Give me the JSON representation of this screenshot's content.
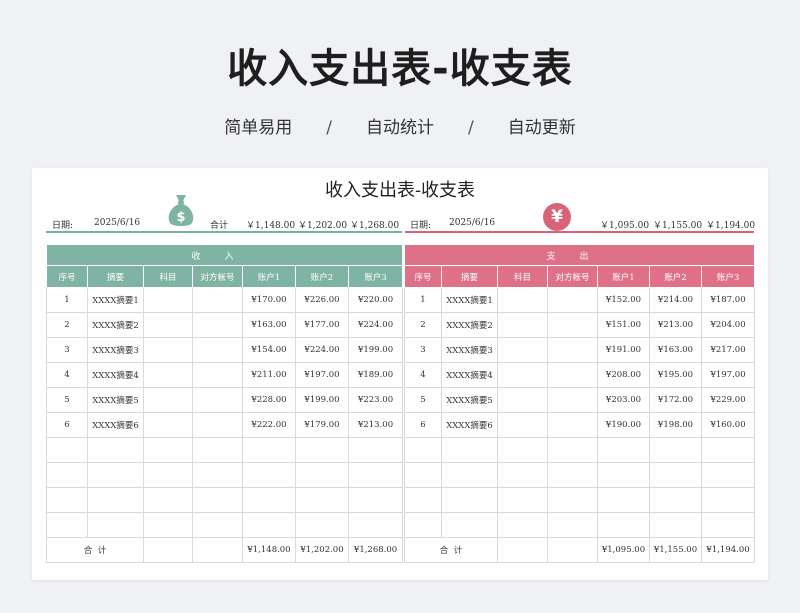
{
  "page": {
    "title": "收入支出表-收支表",
    "subtitle": [
      "简单易用",
      "自动统计",
      "自动更新"
    ],
    "separator": "/"
  },
  "sheet": {
    "title": "收入支出表-收支表",
    "left_icon": "money-bag-icon",
    "right_icon": "yen-circle-icon",
    "accent_income": "#7fb3a3",
    "accent_expense": "#de7088",
    "income": {
      "date_label": "日期:",
      "date": "2025/6/16",
      "total_label": "合计",
      "totals": [
        "￥1,148.00",
        "￥1,202.00",
        "￥1,268.00"
      ],
      "band": "收入",
      "headers": [
        "序号",
        "摘要",
        "科目",
        "对方帐号",
        "账户1",
        "账户2",
        "账户3"
      ],
      "rows": [
        [
          "1",
          "XXXX摘要1",
          "",
          "",
          "¥170.00",
          "¥226.00",
          "¥220.00"
        ],
        [
          "2",
          "XXXX摘要2",
          "",
          "",
          "¥163.00",
          "¥177.00",
          "¥224.00"
        ],
        [
          "3",
          "XXXX摘要3",
          "",
          "",
          "¥154.00",
          "¥224.00",
          "¥199.00"
        ],
        [
          "4",
          "XXXX摘要4",
          "",
          "",
          "¥211.00",
          "¥197.00",
          "¥189.00"
        ],
        [
          "5",
          "XXXX摘要5",
          "",
          "",
          "¥228.00",
          "¥199.00",
          "¥223.00"
        ],
        [
          "6",
          "XXXX摘要6",
          "",
          "",
          "¥222.00",
          "¥179.00",
          "¥213.00"
        ],
        [
          "",
          "",
          "",
          "",
          "",
          "",
          ""
        ],
        [
          "",
          "",
          "",
          "",
          "",
          "",
          ""
        ],
        [
          "",
          "",
          "",
          "",
          "",
          "",
          ""
        ],
        [
          "",
          "",
          "",
          "",
          "",
          "",
          ""
        ]
      ],
      "footer_label": "合  计",
      "footer": [
        "¥1,148.00",
        "¥1,202.00",
        "¥1,268.00"
      ]
    },
    "expense": {
      "date_label": "日期:",
      "date": "2025/6/16",
      "totals": [
        "￥1,095.00",
        "￥1,155.00",
        "￥1,194.00"
      ],
      "band": "支出",
      "headers": [
        "序号",
        "摘要",
        "科目",
        "对方帐号",
        "账户1",
        "账户2",
        "账户3"
      ],
      "rows": [
        [
          "1",
          "XXXX摘要1",
          "",
          "",
          "¥152.00",
          "¥214.00",
          "¥187.00"
        ],
        [
          "2",
          "XXXX摘要2",
          "",
          "",
          "¥151.00",
          "¥213.00",
          "¥204.00"
        ],
        [
          "3",
          "XXXX摘要3",
          "",
          "",
          "¥191.00",
          "¥163.00",
          "¥217.00"
        ],
        [
          "4",
          "XXXX摘要4",
          "",
          "",
          "¥208.00",
          "¥195.00",
          "¥197.00"
        ],
        [
          "5",
          "XXXX摘要5",
          "",
          "",
          "¥203.00",
          "¥172.00",
          "¥229.00"
        ],
        [
          "6",
          "XXXX摘要6",
          "",
          "",
          "¥190.00",
          "¥198.00",
          "¥160.00"
        ],
        [
          "",
          "",
          "",
          "",
          "",
          "",
          ""
        ],
        [
          "",
          "",
          "",
          "",
          "",
          "",
          ""
        ],
        [
          "",
          "",
          "",
          "",
          "",
          "",
          ""
        ],
        [
          "",
          "",
          "",
          "",
          "",
          "",
          ""
        ]
      ],
      "footer_label": "合  计",
      "footer": [
        "¥1,095.00",
        "¥1,155.00",
        "¥1,194.00"
      ]
    }
  }
}
